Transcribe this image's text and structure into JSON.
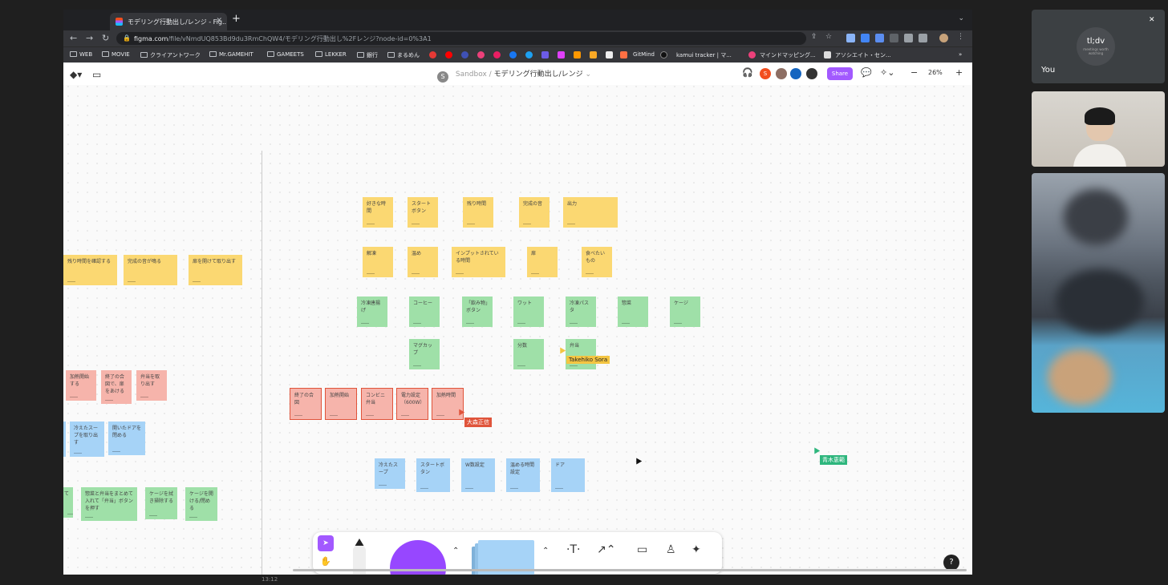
{
  "browser": {
    "tab_title": "モデリング行動出し/レンジ - Fig...",
    "url_host": "figma.com",
    "url_path": "/file/vNmdUQ853Bd9du3RmChQW4/モデリング行動出し%2Fレンジ?node-id=0%3A1"
  },
  "bookmarks": [
    {
      "label": "WEB"
    },
    {
      "label": "MOVIE"
    },
    {
      "label": "クライアントワーク"
    },
    {
      "label": "Mr.GAMEHIT"
    },
    {
      "label": "GAMEETS"
    },
    {
      "label": "LEKKER"
    },
    {
      "label": "銀行"
    },
    {
      "label": "まるめん"
    },
    {
      "label": "GitMind"
    },
    {
      "label": "kamui tracker | マ..."
    },
    {
      "label": "マインドマッピング..."
    },
    {
      "label": "アソシエイト・セン..."
    }
  ],
  "figma": {
    "team_avatar": "S",
    "project": "Sandbox",
    "file": "モデリング行動出し/レンジ",
    "share_label": "Share",
    "zoom": "26%",
    "collaborator_initial": "S"
  },
  "notes": {
    "left_yellow": [
      "残り時間を確認する",
      "完成の音が鳴る",
      "扉を開けて取り出す"
    ],
    "left_red": [
      "加熱開始する",
      "終了の合図で、扉をあける",
      "弁当を取り出す"
    ],
    "left_blue": [
      "冷えたスープを取り出す",
      "開いたドアを閉める"
    ],
    "left_green": [
      "て",
      "惣菜と弁当をまとめて入れて「弁当」ボタンを押す",
      "ケージを拭き掃除する",
      "ケージを開ける/閉める"
    ],
    "top_yellow_row1": [
      "好きな時間",
      "スタートボタン",
      "残り時間",
      "完成の音",
      "出力"
    ],
    "top_yellow_row2": [
      "解凍",
      "温め",
      "インプットされている時間",
      "扉",
      "食べたいもの"
    ],
    "green_row1": [
      "冷凍唐揚げ",
      "コーヒー",
      "「飲み物」ボタン",
      "ワット",
      "冷凍パスタ",
      "惣菜",
      "ケージ"
    ],
    "green_row2": [
      "マグカップ",
      "分数",
      "弁当"
    ],
    "red_row": [
      "終了の合図",
      "加熱開始",
      "コンビニ弁当",
      "電力設定（600W）",
      "加熱時間"
    ],
    "blue_row": [
      "冷えたスープ",
      "スタートボタン",
      "W数設定",
      "温める時間設定",
      "ドア"
    ]
  },
  "cursors": {
    "yellow_user": "Takehiko Sora",
    "red_user": "大森正信",
    "green_user": "青木恵範"
  },
  "meet": {
    "you_label": "You",
    "tldv_logo": "tl;dv",
    "tldv_caption": "meetings worth watching",
    "timestamp": "13:12"
  },
  "colors": {
    "figma_purple": "#a259ff",
    "note_yellow": "#fbd872",
    "note_green": "#9fe0a8",
    "note_red": "#f6b4ab",
    "note_blue": "#a6d3f7"
  }
}
